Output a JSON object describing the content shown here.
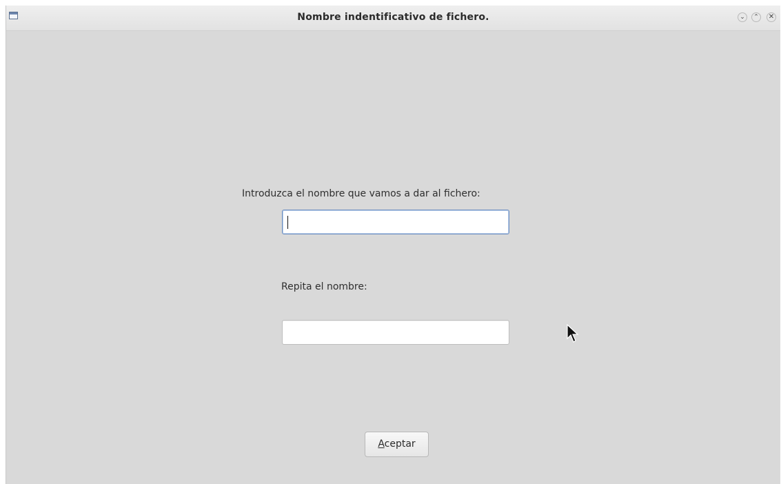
{
  "window": {
    "title": "Nombre indentificativo de fichero.",
    "controls": {
      "minimize_icon": "chevron-down-icon",
      "maximize_icon": "chevron-up-icon",
      "close_icon": "close-icon"
    }
  },
  "form": {
    "label_name": "Introduzca el nombre que vamos a dar al fichero:",
    "name_value": "",
    "label_repeat": "Repita el nombre:",
    "repeat_value": "",
    "accept_label_rest": "ceptar",
    "accept_label_mnemonic": "A"
  },
  "colors": {
    "background": "#d9d9d9",
    "focus_border": "#6d8fc2"
  }
}
